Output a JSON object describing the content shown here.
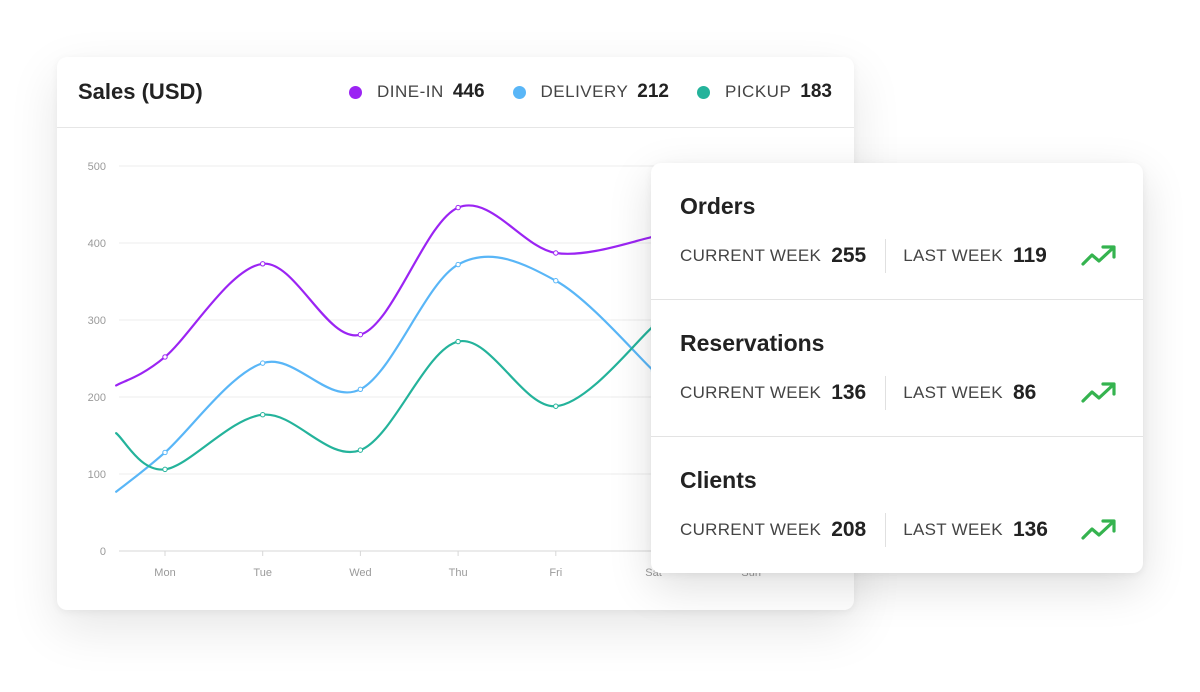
{
  "colors": {
    "dine_in": "#9b24f3",
    "delivery": "#59b6f7",
    "pickup": "#24b39b",
    "trend_up": "#35b34f"
  },
  "sales": {
    "title": "Sales (USD)",
    "legend": [
      {
        "label": "DINE-IN",
        "value": "446",
        "color": "#9b24f3"
      },
      {
        "label": "DELIVERY",
        "value": "212",
        "color": "#59b6f7"
      },
      {
        "label": "PICKUP",
        "value": "183",
        "color": "#24b39b"
      }
    ]
  },
  "chart_data": {
    "type": "line",
    "title": "Sales (USD)",
    "categories": [
      "Mon",
      "Tue",
      "Wed",
      "Thu",
      "Fri",
      "Sat",
      "Sun"
    ],
    "x_ticks": [
      "Mon",
      "Tue",
      "Wed",
      "Thu",
      "Fri",
      "Sat",
      "Sun"
    ],
    "ylim": [
      0,
      500
    ],
    "yticks": [
      0,
      100,
      200,
      300,
      400,
      500
    ],
    "grid": true,
    "smooth": true,
    "series": [
      {
        "name": "DINE-IN",
        "color": "#9b24f3",
        "x": [
          -0.5,
          0,
          1,
          2,
          3,
          4,
          5
        ],
        "values": [
          215,
          252,
          373,
          281,
          446,
          387,
          408
        ]
      },
      {
        "name": "DELIVERY",
        "color": "#59b6f7",
        "x": [
          -0.5,
          0,
          1,
          2,
          3,
          4,
          5
        ],
        "values": [
          77,
          128,
          244,
          210,
          372,
          351,
          234
        ]
      },
      {
        "name": "PICKUP",
        "color": "#24b39b",
        "x": [
          -0.5,
          0,
          1,
          2,
          3,
          4,
          5
        ],
        "values": [
          153,
          106,
          177,
          131,
          272,
          188,
          292
        ]
      }
    ]
  },
  "stats": [
    {
      "title": "Orders",
      "current_label": "CURRENT WEEK",
      "current_value": "255",
      "last_label": "LAST WEEK",
      "last_value": "119",
      "trend": "trending-up-icon"
    },
    {
      "title": "Reservations",
      "current_label": "CURRENT WEEK",
      "current_value": "136",
      "last_label": "LAST WEEK",
      "last_value": "86",
      "trend": "trending-up-icon"
    },
    {
      "title": "Clients",
      "current_label": "CURRENT WEEK",
      "current_value": "208",
      "last_label": "LAST WEEK",
      "last_value": "136",
      "trend": "trending-up-icon"
    }
  ]
}
